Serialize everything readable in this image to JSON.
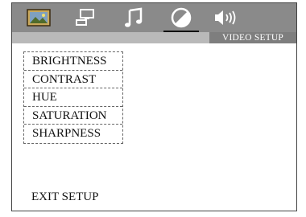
{
  "tabs": [
    {
      "icon": "picture-icon"
    },
    {
      "icon": "monitor-setup-icon"
    },
    {
      "icon": "music-note-icon"
    },
    {
      "icon": "video-setup-icon",
      "active": true
    },
    {
      "icon": "speaker-audio-icon"
    }
  ],
  "header": {
    "section_title": "VIDEO SETUP"
  },
  "menu": {
    "items": [
      {
        "label": "BRIGHTNESS"
      },
      {
        "label": "CONTRAST"
      },
      {
        "label": "HUE"
      },
      {
        "label": "SATURATION"
      },
      {
        "label": "SHARPNESS"
      }
    ]
  },
  "footer": {
    "exit_label": "EXIT SETUP"
  },
  "colors": {
    "topbar": "#8a8a8a",
    "subbar": "#b9b9b9",
    "label_bg": "#7e7e7e",
    "text": "#111111"
  }
}
